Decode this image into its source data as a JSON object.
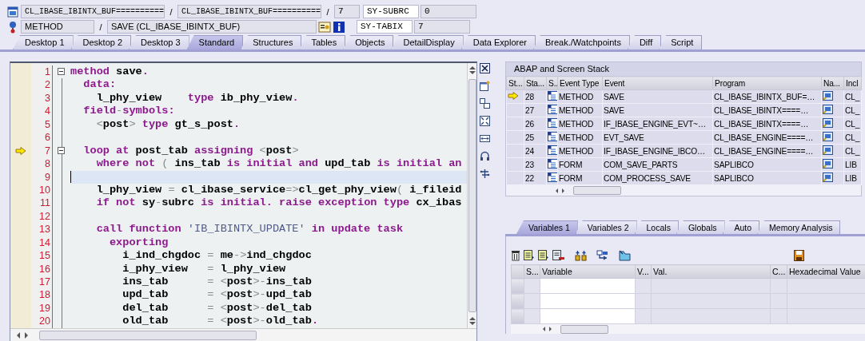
{
  "header": {
    "rows": [
      {
        "items": [
          {
            "kind": "program",
            "text": "CL_IBASE_IBINTX_BUF=========="
          },
          {
            "kind": "sep",
            "text": "/"
          },
          {
            "kind": "include",
            "text": "CL_IBASE_IBINTX_BUF=========="
          },
          {
            "kind": "sep",
            "text": "/"
          },
          {
            "kind": "line",
            "text": "7"
          },
          {
            "kind": "sysname",
            "text": "SY-SUBRC"
          },
          {
            "kind": "sysvalue",
            "text": "0"
          }
        ]
      },
      {
        "items": [
          {
            "kind": "eventtype",
            "text": "METHOD"
          },
          {
            "kind": "sep",
            "text": "/"
          },
          {
            "kind": "event",
            "text": "SAVE (CL_IBASE_IBINTX_BUF)"
          },
          {
            "kind": "sysname",
            "text": "SY-TABIX"
          },
          {
            "kind": "sysvalue",
            "text": "7"
          }
        ]
      }
    ]
  },
  "tabs": [
    {
      "label": "Desktop 1",
      "selected": false
    },
    {
      "label": "Desktop 2",
      "selected": false
    },
    {
      "label": "Desktop 3",
      "selected": false
    },
    {
      "label": "Standard",
      "selected": true
    },
    {
      "label": "Structures",
      "selected": false
    },
    {
      "label": "Tables",
      "selected": false
    },
    {
      "label": "Objects",
      "selected": false
    },
    {
      "label": "DetailDisplay",
      "selected": false
    },
    {
      "label": "Data Explorer",
      "selected": false
    },
    {
      "label": "Break./Watchpoints",
      "selected": false
    },
    {
      "label": "Diff",
      "selected": false
    },
    {
      "label": "Script",
      "selected": false
    }
  ],
  "editor": {
    "lines": [
      {
        "number": "1",
        "fold": true,
        "current": false,
        "cursor": false,
        "segments": [
          {
            "kind": "kw",
            "text": "method"
          },
          {
            "kind": "id",
            "text": " save"
          },
          {
            "kind": "kw",
            "text": "."
          }
        ]
      },
      {
        "number": "2",
        "fold": false,
        "current": false,
        "cursor": false,
        "segments": [
          {
            "kind": "kw",
            "text": "  data:"
          }
        ]
      },
      {
        "number": "3",
        "fold": false,
        "current": false,
        "cursor": false,
        "segments": [
          {
            "kind": "id",
            "text": "    l_phy_view    "
          },
          {
            "kind": "kw",
            "text": "type"
          },
          {
            "kind": "id",
            "text": " ib_phy_view"
          },
          {
            "kind": "kw",
            "text": "."
          }
        ]
      },
      {
        "number": "4",
        "fold": false,
        "current": false,
        "cursor": false,
        "segments": [
          {
            "kind": "kw",
            "text": "  field"
          },
          {
            "kind": "op",
            "text": "-"
          },
          {
            "kind": "kw",
            "text": "symbols:"
          }
        ]
      },
      {
        "number": "5",
        "fold": false,
        "current": false,
        "cursor": false,
        "segments": [
          {
            "kind": "op",
            "text": "    <"
          },
          {
            "kind": "id",
            "text": "post"
          },
          {
            "kind": "op",
            "text": ">"
          },
          {
            "kind": "kw",
            "text": " type"
          },
          {
            "kind": "id",
            "text": " gt_s_post"
          },
          {
            "kind": "kw",
            "text": "."
          }
        ]
      },
      {
        "number": "6",
        "fold": false,
        "current": false,
        "cursor": false
      },
      {
        "number": "7",
        "fold": true,
        "current": true,
        "cursor": false,
        "segments": [
          {
            "kind": "kw",
            "text": "  loop at"
          },
          {
            "kind": "id",
            "text": " post_tab"
          },
          {
            "kind": "kw",
            "text": " assigning"
          },
          {
            "kind": "op",
            "text": " <"
          },
          {
            "kind": "id",
            "text": "post"
          },
          {
            "kind": "op",
            "text": ">"
          }
        ]
      },
      {
        "number": "8",
        "fold": false,
        "current": false,
        "cursor": false,
        "segments": [
          {
            "kind": "kw",
            "text": "    where not"
          },
          {
            "kind": "op",
            "text": " ("
          },
          {
            "kind": "id",
            "text": " ins_tab"
          },
          {
            "kind": "kw",
            "text": " is initial and"
          },
          {
            "kind": "id",
            "text": " upd_tab"
          },
          {
            "kind": "kw",
            "text": " is initial an"
          }
        ]
      },
      {
        "number": "9",
        "fold": false,
        "current": false,
        "cursor": true
      },
      {
        "number": "10",
        "fold": false,
        "current": false,
        "cursor": false,
        "segments": [
          {
            "kind": "id",
            "text": "    l_phy_view"
          },
          {
            "kind": "op",
            "text": " ="
          },
          {
            "kind": "id",
            "text": " cl_ibase_service"
          },
          {
            "kind": "op",
            "text": "=>"
          },
          {
            "kind": "id",
            "text": "cl_get_phy_view"
          },
          {
            "kind": "op",
            "text": "("
          },
          {
            "kind": "id",
            "text": " i_fileid"
          }
        ]
      },
      {
        "number": "11",
        "fold": false,
        "current": false,
        "cursor": false,
        "segments": [
          {
            "kind": "kw",
            "text": "    if not"
          },
          {
            "kind": "id",
            "text": " sy"
          },
          {
            "kind": "op",
            "text": "-"
          },
          {
            "kind": "id",
            "text": "subrc"
          },
          {
            "kind": "kw",
            "text": " is initial. raise exception type"
          },
          {
            "kind": "id",
            "text": " cx_ibas"
          }
        ]
      },
      {
        "number": "12",
        "fold": false,
        "current": false,
        "cursor": false
      },
      {
        "number": "13",
        "fold": false,
        "current": false,
        "cursor": false,
        "segments": [
          {
            "kind": "kw",
            "text": "    call function"
          },
          {
            "kind": "str",
            "text": " 'IB_IBINTX_UPDATE'"
          },
          {
            "kind": "kw",
            "text": " in update task"
          }
        ]
      },
      {
        "number": "14",
        "fold": false,
        "current": false,
        "cursor": false,
        "segments": [
          {
            "kind": "kw",
            "text": "      exporting"
          }
        ]
      },
      {
        "number": "15",
        "fold": false,
        "current": false,
        "cursor": false,
        "segments": [
          {
            "kind": "id",
            "text": "        i_ind_chgdoc"
          },
          {
            "kind": "op",
            "text": " ="
          },
          {
            "kind": "id",
            "text": " me"
          },
          {
            "kind": "op",
            "text": "->"
          },
          {
            "kind": "id",
            "text": "ind_chgdoc"
          }
        ]
      },
      {
        "number": "16",
        "fold": false,
        "current": false,
        "cursor": false,
        "segments": [
          {
            "kind": "id",
            "text": "        i_phy_view"
          },
          {
            "kind": "op",
            "text": "   ="
          },
          {
            "kind": "id",
            "text": " l_phy_view"
          }
        ]
      },
      {
        "number": "17",
        "fold": false,
        "current": false,
        "cursor": false,
        "segments": [
          {
            "kind": "id",
            "text": "        ins_tab"
          },
          {
            "kind": "op",
            "text": "      = <"
          },
          {
            "kind": "id",
            "text": "post"
          },
          {
            "kind": "op",
            "text": ">-"
          },
          {
            "kind": "id",
            "text": "ins_tab"
          }
        ]
      },
      {
        "number": "18",
        "fold": false,
        "current": false,
        "cursor": false,
        "segments": [
          {
            "kind": "id",
            "text": "        upd_tab"
          },
          {
            "kind": "op",
            "text": "      = <"
          },
          {
            "kind": "id",
            "text": "post"
          },
          {
            "kind": "op",
            "text": ">-"
          },
          {
            "kind": "id",
            "text": "upd_tab"
          }
        ]
      },
      {
        "number": "19",
        "fold": false,
        "current": false,
        "cursor": false,
        "segments": [
          {
            "kind": "id",
            "text": "        del_tab"
          },
          {
            "kind": "op",
            "text": "      = <"
          },
          {
            "kind": "id",
            "text": "post"
          },
          {
            "kind": "op",
            "text": ">-"
          },
          {
            "kind": "id",
            "text": "del_tab"
          }
        ]
      },
      {
        "number": "20",
        "fold": false,
        "current": false,
        "cursor": false,
        "segments": [
          {
            "kind": "id",
            "text": "        old_tab"
          },
          {
            "kind": "op",
            "text": "      = <"
          },
          {
            "kind": "id",
            "text": "post"
          },
          {
            "kind": "op",
            "text": ">-"
          },
          {
            "kind": "id",
            "text": "old_tab"
          },
          {
            "kind": "kw",
            "text": "."
          }
        ]
      }
    ]
  },
  "stack": {
    "title": "ABAP and Screen Stack",
    "columns": [
      "St...",
      "Sta...",
      "S..",
      "Event Type",
      "Event",
      "Program",
      "Na...",
      "Incl"
    ],
    "rows": [
      {
        "current": true,
        "level": "28",
        "event_type": "METHOD",
        "event": "SAVE",
        "program": "CL_IBASE_IBINTX_BUF=…",
        "include": "CL_"
      },
      {
        "current": false,
        "level": "27",
        "event_type": "METHOD",
        "event": "SAVE",
        "program": "CL_IBASE_IBINTX====…",
        "include": "CL_"
      },
      {
        "current": false,
        "level": "26",
        "event_type": "METHOD",
        "event": "IF_IBASE_ENGINE_EVT~…",
        "program": "CL_IBASE_IBINTX====…",
        "include": "CL_"
      },
      {
        "current": false,
        "level": "25",
        "event_type": "METHOD",
        "event": "EVT_SAVE",
        "program": "CL_IBASE_ENGINE====…",
        "include": "CL_"
      },
      {
        "current": false,
        "level": "24",
        "event_type": "METHOD",
        "event": "IF_IBASE_ENGINE_IBCO…",
        "program": "CL_IBASE_ENGINE====…",
        "include": "CL_"
      },
      {
        "current": false,
        "level": "23",
        "event_type": "FORM",
        "event": "COM_SAVE_PARTS",
        "program": "SAPLIBCO",
        "include": "LIB"
      },
      {
        "current": false,
        "level": "22",
        "event_type": "FORM",
        "event": "COM_PROCESS_SAVE",
        "program": "SAPLIBCO",
        "include": "LIB"
      }
    ]
  },
  "variables": {
    "tabs": [
      {
        "label": "Variables 1",
        "selected": true
      },
      {
        "label": "Variables 2",
        "selected": false
      },
      {
        "label": "Locals",
        "selected": false
      },
      {
        "label": "Globals",
        "selected": false
      },
      {
        "label": "Auto",
        "selected": false
      },
      {
        "label": "Memory Analysis",
        "selected": false
      }
    ],
    "columns": [
      "S...",
      "Variable",
      "V...",
      "Val.",
      "C...",
      "Hexadecimal Value"
    ]
  }
}
